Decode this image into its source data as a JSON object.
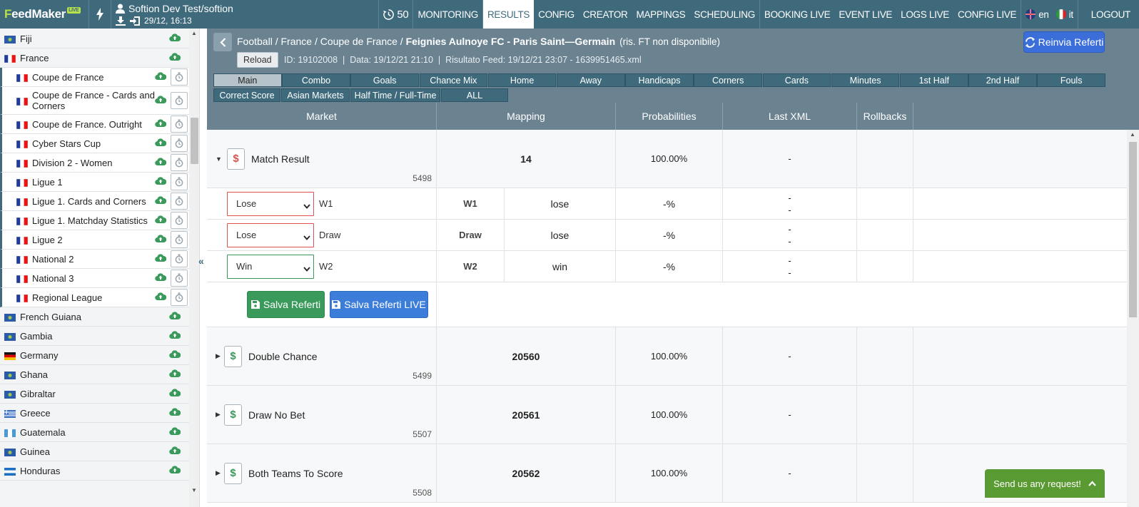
{
  "app": {
    "logo_a": "F",
    "logo_b": "eedMaker",
    "logo_live": "LIVE"
  },
  "user": {
    "name": "Softion Dev Test/softion",
    "date": "29/12, 16:13"
  },
  "topnav": {
    "counter": "50",
    "items": [
      "MONITORING",
      "RESULTS",
      "CONFIG",
      "CREATOR",
      "MAPPINGS",
      "SCHEDULING",
      "BOOKING LIVE",
      "EVENT LIVE",
      "LOGS LIVE",
      "CONFIG LIVE"
    ],
    "active": "RESULTS",
    "lang_en": "en",
    "lang_it": "it",
    "logout": "LOGOUT"
  },
  "sidebar": {
    "rows": [
      {
        "name": "Fiji",
        "kind": "country",
        "flag": "blue"
      },
      {
        "name": "France",
        "kind": "country",
        "flag": "fr"
      },
      {
        "name": "Coupe de France",
        "kind": "child",
        "flag": "fr"
      },
      {
        "name": "Coupe de France - Cards and Corners",
        "kind": "child",
        "flag": "fr",
        "tall": true
      },
      {
        "name": "Coupe de France. Outright",
        "kind": "child",
        "flag": "fr"
      },
      {
        "name": "Cyber Stars Cup",
        "kind": "child",
        "flag": "fr"
      },
      {
        "name": "Division 2 - Women",
        "kind": "child",
        "flag": "fr"
      },
      {
        "name": "Ligue 1",
        "kind": "child",
        "flag": "fr"
      },
      {
        "name": "Ligue 1. Cards and Corners",
        "kind": "child",
        "flag": "fr"
      },
      {
        "name": "Ligue 1. Matchday Statistics",
        "kind": "child",
        "flag": "fr"
      },
      {
        "name": "Ligue 2",
        "kind": "child",
        "flag": "fr"
      },
      {
        "name": "National 2",
        "kind": "child",
        "flag": "fr"
      },
      {
        "name": "National 3",
        "kind": "child",
        "flag": "fr"
      },
      {
        "name": "Regional League",
        "kind": "child",
        "flag": "fr"
      },
      {
        "name": "French Guiana",
        "kind": "country",
        "flag": "blue"
      },
      {
        "name": "Gambia",
        "kind": "country",
        "flag": "blue"
      },
      {
        "name": "Germany",
        "kind": "country",
        "flag": "de"
      },
      {
        "name": "Ghana",
        "kind": "country",
        "flag": "blue"
      },
      {
        "name": "Gibraltar",
        "kind": "country",
        "flag": "blue"
      },
      {
        "name": "Greece",
        "kind": "country",
        "flag": "gr"
      },
      {
        "name": "Guatemala",
        "kind": "country",
        "flag": "gt"
      },
      {
        "name": "Guinea",
        "kind": "country",
        "flag": "blue"
      },
      {
        "name": "Honduras",
        "kind": "country",
        "flag": "hn"
      }
    ]
  },
  "event": {
    "crumb_path": "Football / France / Coupe de France / ",
    "match": "Feignies Aulnoye FC - Paris Saint—Germain",
    "ris": "(ris. FT non disponibile)",
    "reload": "Reload",
    "meta": "ID: 19102008  |  Data: 19/12/21 21:10  |  Risultato Feed: 19/12/21 23:07 - 1639951465.xml",
    "reinvia": "Reinvia Referti"
  },
  "tabs": {
    "row1": [
      "Main",
      "Combo",
      "Goals",
      "Chance Mix",
      "Home",
      "Away",
      "Handicaps",
      "Corners",
      "Cards",
      "Minutes",
      "1st Half",
      "2nd Half",
      "Fouls"
    ],
    "row2": [
      "Correct Score",
      "Asian Markets",
      "Half Time / Full-Time",
      "ALL"
    ],
    "active": "Main"
  },
  "columns": [
    "Market",
    "Mapping",
    "Probabilities",
    "Last XML",
    "Rollbacks"
  ],
  "markets": [
    {
      "name": "Match Result",
      "id": "5498",
      "mapping": "14",
      "prob": "100.00%",
      "last": "-",
      "expanded": true,
      "icon_color": "#d9534f"
    },
    {
      "name": "Double Chance",
      "id": "5499",
      "mapping": "20560",
      "prob": "100.00%",
      "last": "-",
      "icon_color": "#3a9a5b"
    },
    {
      "name": "Draw No Bet",
      "id": "5507",
      "mapping": "20561",
      "prob": "100.00%",
      "last": "-",
      "icon_color": "#3a9a5b"
    },
    {
      "name": "Both Teams To Score",
      "id": "5508",
      "mapping": "20562",
      "prob": "100.00%",
      "last": "-",
      "icon_color": "#3a9a5b"
    }
  ],
  "outcomes": [
    {
      "select": "Lose",
      "name": "W1",
      "map_code": "W1",
      "map_val": "lose",
      "prob": "-%",
      "last1": "-",
      "last2": "-",
      "border": "#d9534f"
    },
    {
      "select": "Lose",
      "name": "Draw",
      "map_code": "Draw",
      "map_val": "lose",
      "prob": "-%",
      "last1": "-",
      "last2": "-",
      "border": "#d9534f"
    },
    {
      "select": "Win",
      "name": "W2",
      "map_code": "W2",
      "map_val": "win",
      "prob": "-%",
      "last1": "-",
      "last2": "-",
      "border": "#3a9a5b"
    }
  ],
  "buttons": {
    "salva": "Salva Referti",
    "salva_live": "Salva Referti LIVE"
  },
  "send_request": "Send us any request!",
  "colors": {
    "topbar": "#3f6a7c",
    "header": "#6b8391",
    "accent_green": "#3a9a5b",
    "accent_blue": "#3b7dd8",
    "accent_red": "#d9534f"
  }
}
